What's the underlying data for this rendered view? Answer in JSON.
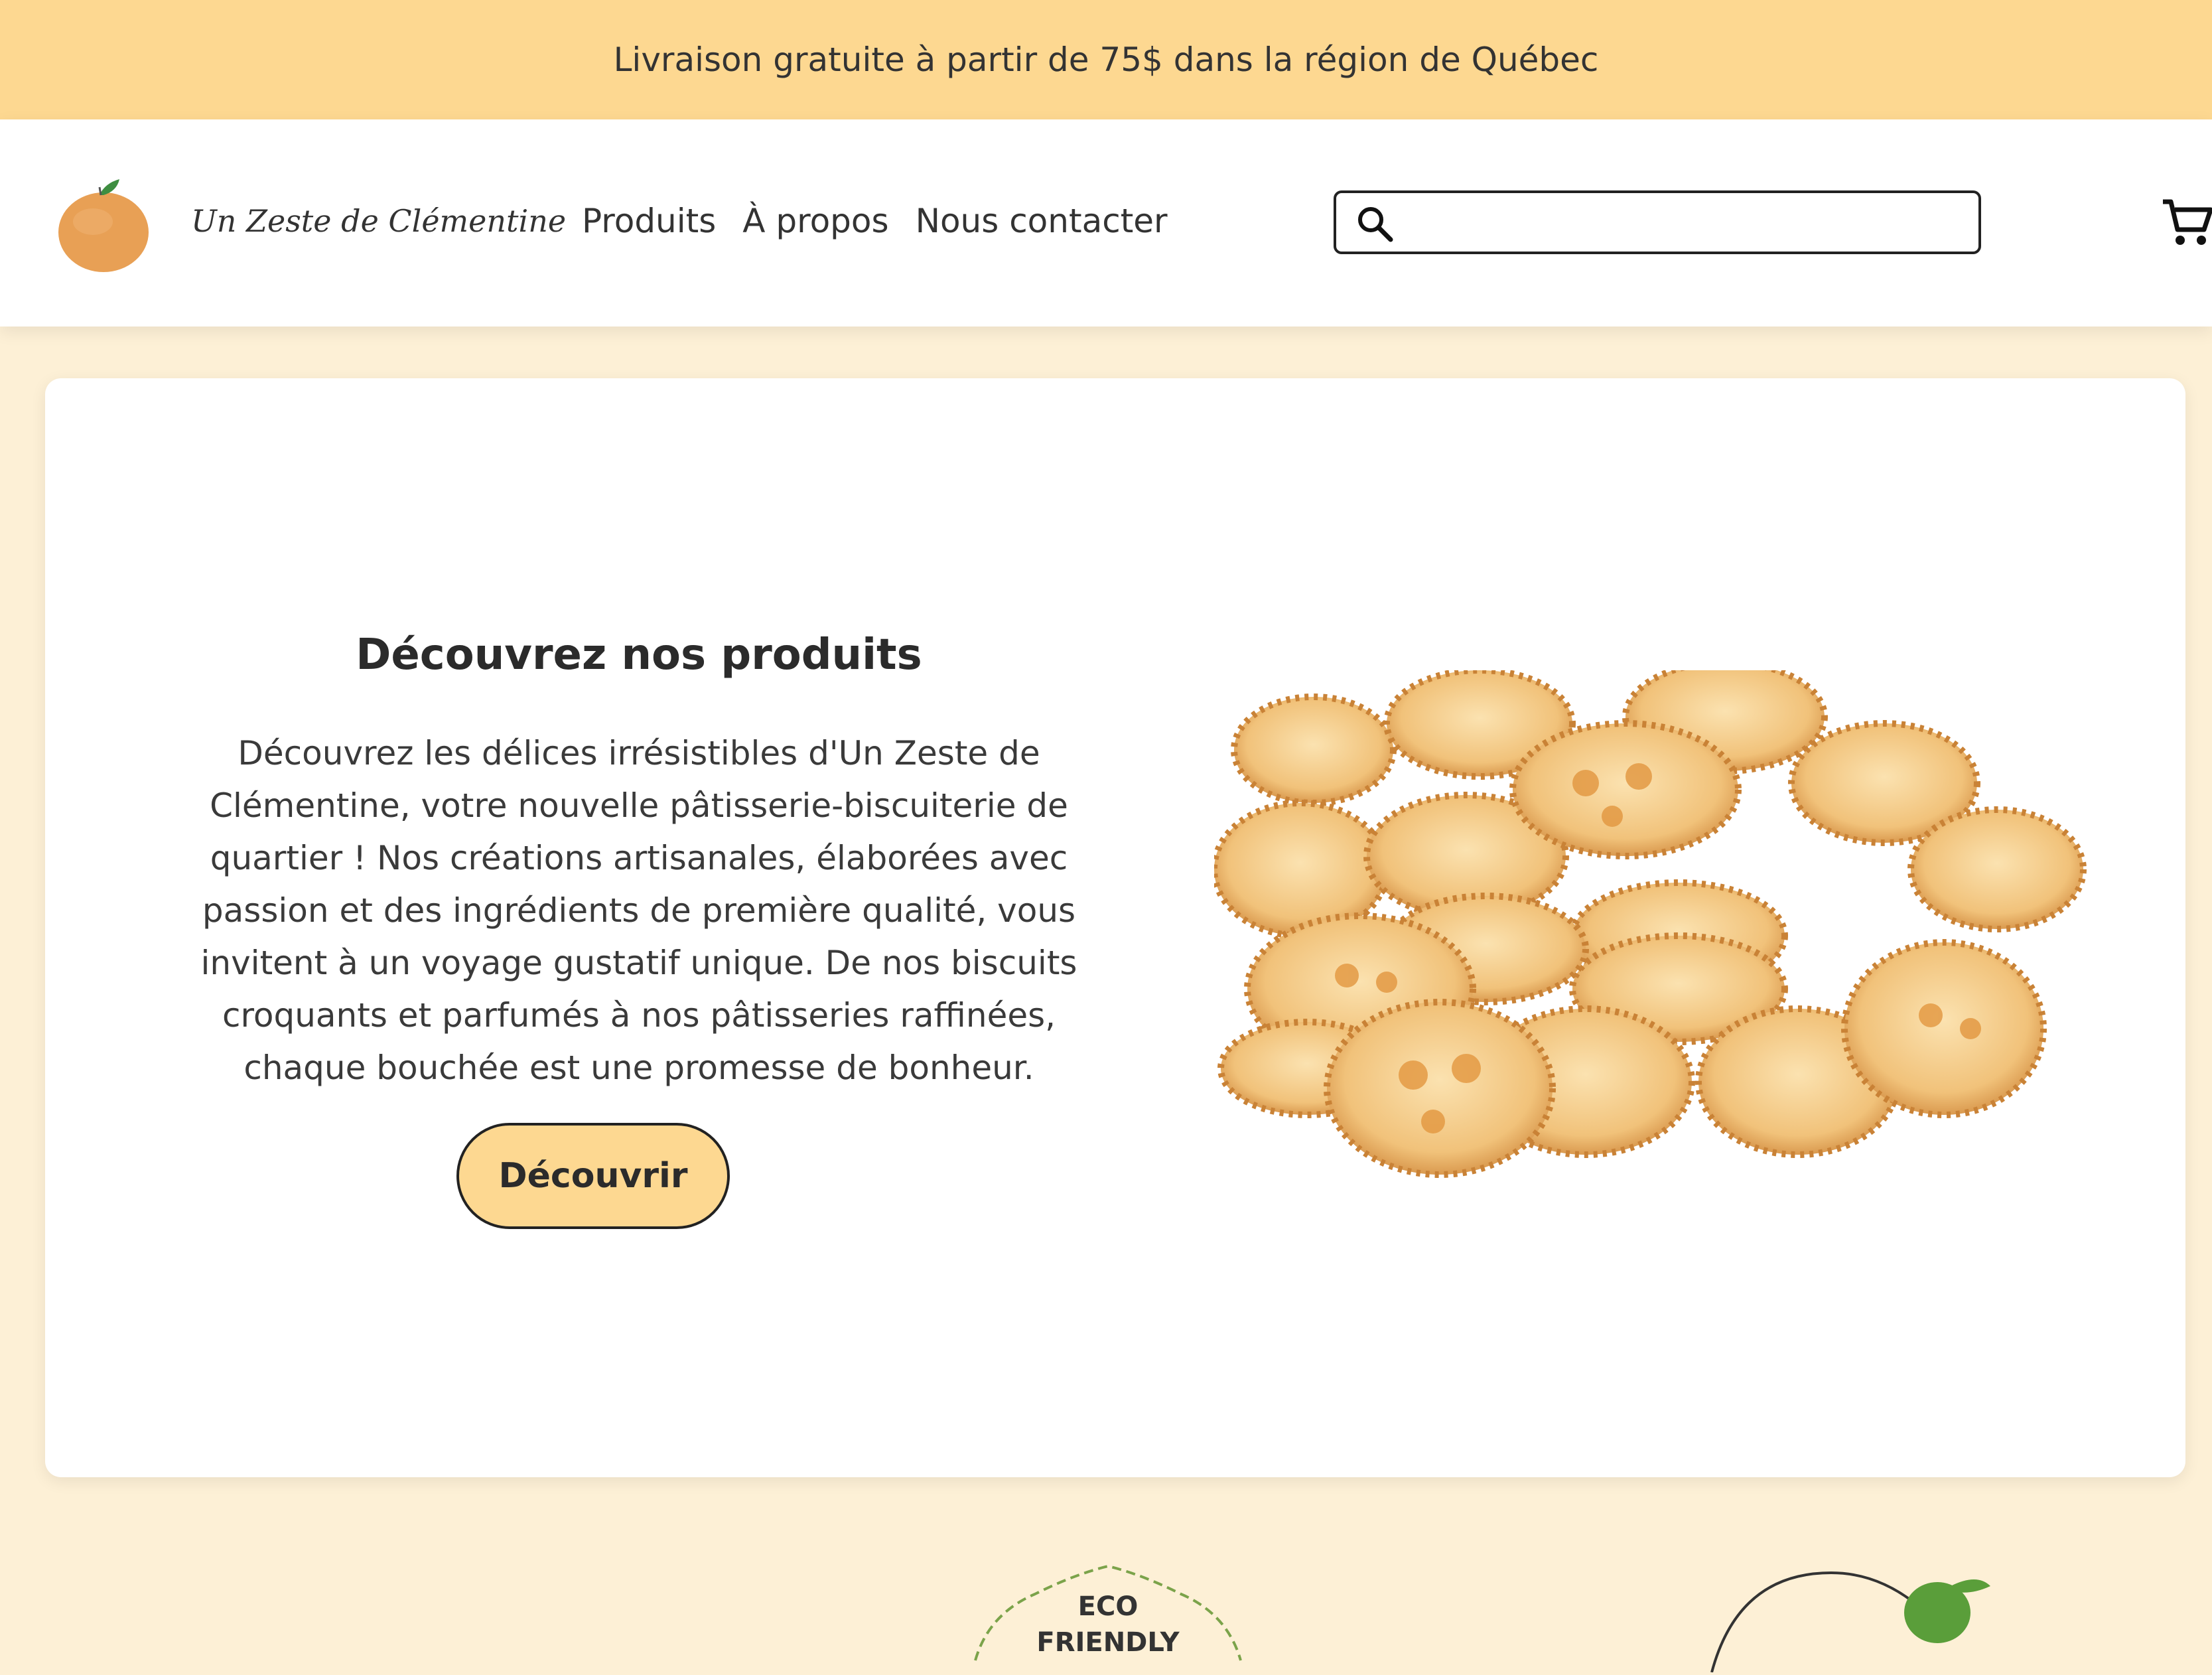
{
  "promo": {
    "text": "Livraison gratuite à partir de 75$ dans la région de Québec"
  },
  "header": {
    "brand": "Un Zeste de Clémentine",
    "nav": [
      {
        "label": "Produits"
      },
      {
        "label": "À propos"
      },
      {
        "label": "Nous contacter"
      }
    ],
    "search": {
      "placeholder": "",
      "value": ""
    },
    "icons": {
      "search": "search-icon",
      "cart": "cart-icon",
      "logo": "clementine-logo-icon"
    }
  },
  "hero": {
    "title": "Découvrez nos produits",
    "description": "Découvrez les délices irrésistibles d'Un Zeste de Clémentine, votre nouvelle pâtisserie-biscuiterie de quartier ! Nos créations artisanales, élaborées avec passion et des ingrédients de première qualité, vous invitent à un voyage gustatif unique. De nos biscuits croquants et parfumés à nos pâtisseries raffinées, chaque bouchée est une promesse de bonheur.",
    "button_label": "Découvrir"
  },
  "badges": {
    "eco_line1": "ECO",
    "eco_line2": "FRIENDLY"
  },
  "colors": {
    "banner": "#fdd891",
    "page_background": "#fdf0d6",
    "button": "#fdd891",
    "text": "#2b2b2b"
  }
}
